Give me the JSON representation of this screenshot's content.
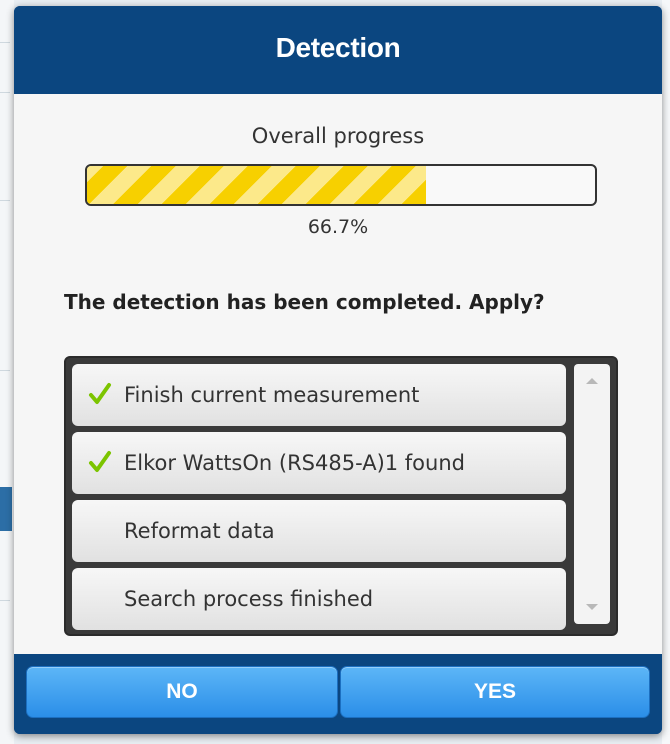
{
  "dialog": {
    "title": "Detection"
  },
  "progress": {
    "label": "Overall progress",
    "value_text": "66.7%",
    "fraction": 0.667
  },
  "question": "The detection has been completed. Apply?",
  "steps": [
    {
      "label": "Finish current measurement",
      "done": true
    },
    {
      "label": "Elkor WattsOn (RS485-A)1 found",
      "done": true
    },
    {
      "label": "Reformat data",
      "done": false
    },
    {
      "label": "Search process finished",
      "done": false
    }
  ],
  "buttons": {
    "no_label": "NO",
    "yes_label": "YES"
  },
  "icons": {
    "check": "check-icon",
    "scroll_up": "chevron-up-icon",
    "scroll_down": "chevron-down-icon"
  },
  "colors": {
    "header_bg": "#0b4680",
    "progress_stripe_a": "#f7d000",
    "progress_stripe_b": "#fce98a",
    "check_green": "#7cc400",
    "button_blue": "#2b8ee8"
  }
}
